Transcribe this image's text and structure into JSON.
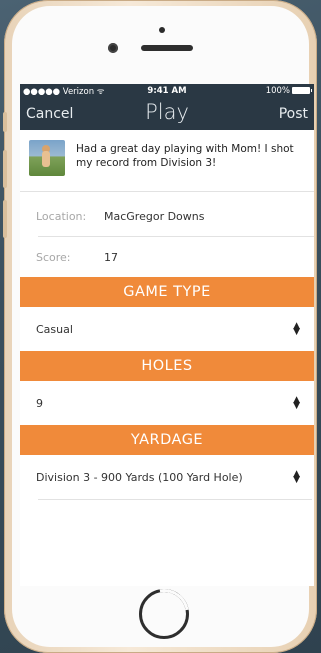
{
  "status_bar": {
    "carrier": "●●●●● Verizon",
    "time": "9:41 AM",
    "battery": "100%"
  },
  "nav": {
    "cancel_label": "Cancel",
    "title": "Play",
    "post_label": "Post"
  },
  "post": {
    "text": "Had a great day playing with Mom! I shot my record from Division 3!"
  },
  "fields": {
    "location_label": "Location:",
    "location_value": "MacGregor Downs",
    "score_label": "Score:",
    "score_value": "17"
  },
  "sections": {
    "game_type": {
      "header": "GAME TYPE",
      "value": "Casual"
    },
    "holes": {
      "header": "HOLES",
      "value": "9"
    },
    "yardage": {
      "header": "YARDAGE",
      "value": "Division 3 - 900 Yards (100 Yard Hole)"
    }
  },
  "colors": {
    "navbar": "#2a3844",
    "accent": "#f08a3a"
  }
}
